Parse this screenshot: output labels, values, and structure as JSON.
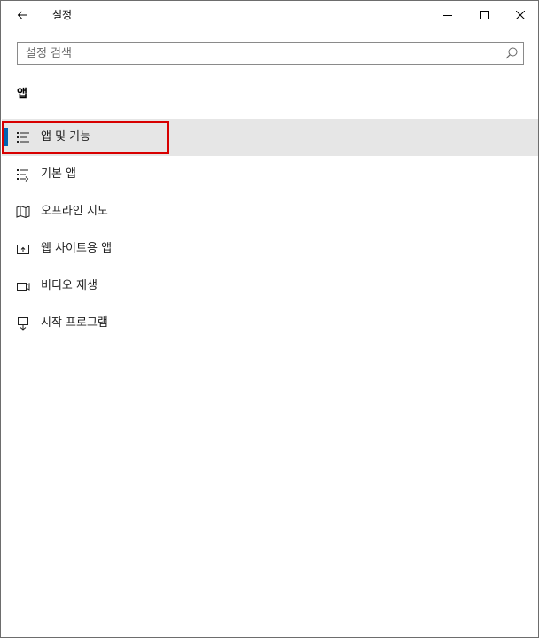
{
  "window": {
    "title": "설정",
    "controls": [
      "minimize",
      "maximize",
      "close"
    ]
  },
  "search": {
    "placeholder": "설정 검색",
    "value": ""
  },
  "section": {
    "title": "앱"
  },
  "nav": {
    "selected_index": 0,
    "accent_color": "#0063b1",
    "highlight_color": "#d80000",
    "items": [
      {
        "label": "앱 및 기능",
        "icon": "apps-features-icon"
      },
      {
        "label": "기본 앱",
        "icon": "default-apps-icon"
      },
      {
        "label": "오프라인 지도",
        "icon": "offline-maps-icon"
      },
      {
        "label": "웹 사이트용 앱",
        "icon": "apps-for-websites-icon"
      },
      {
        "label": "비디오 재생",
        "icon": "video-playback-icon"
      },
      {
        "label": "시작 프로그램",
        "icon": "startup-icon"
      }
    ]
  }
}
